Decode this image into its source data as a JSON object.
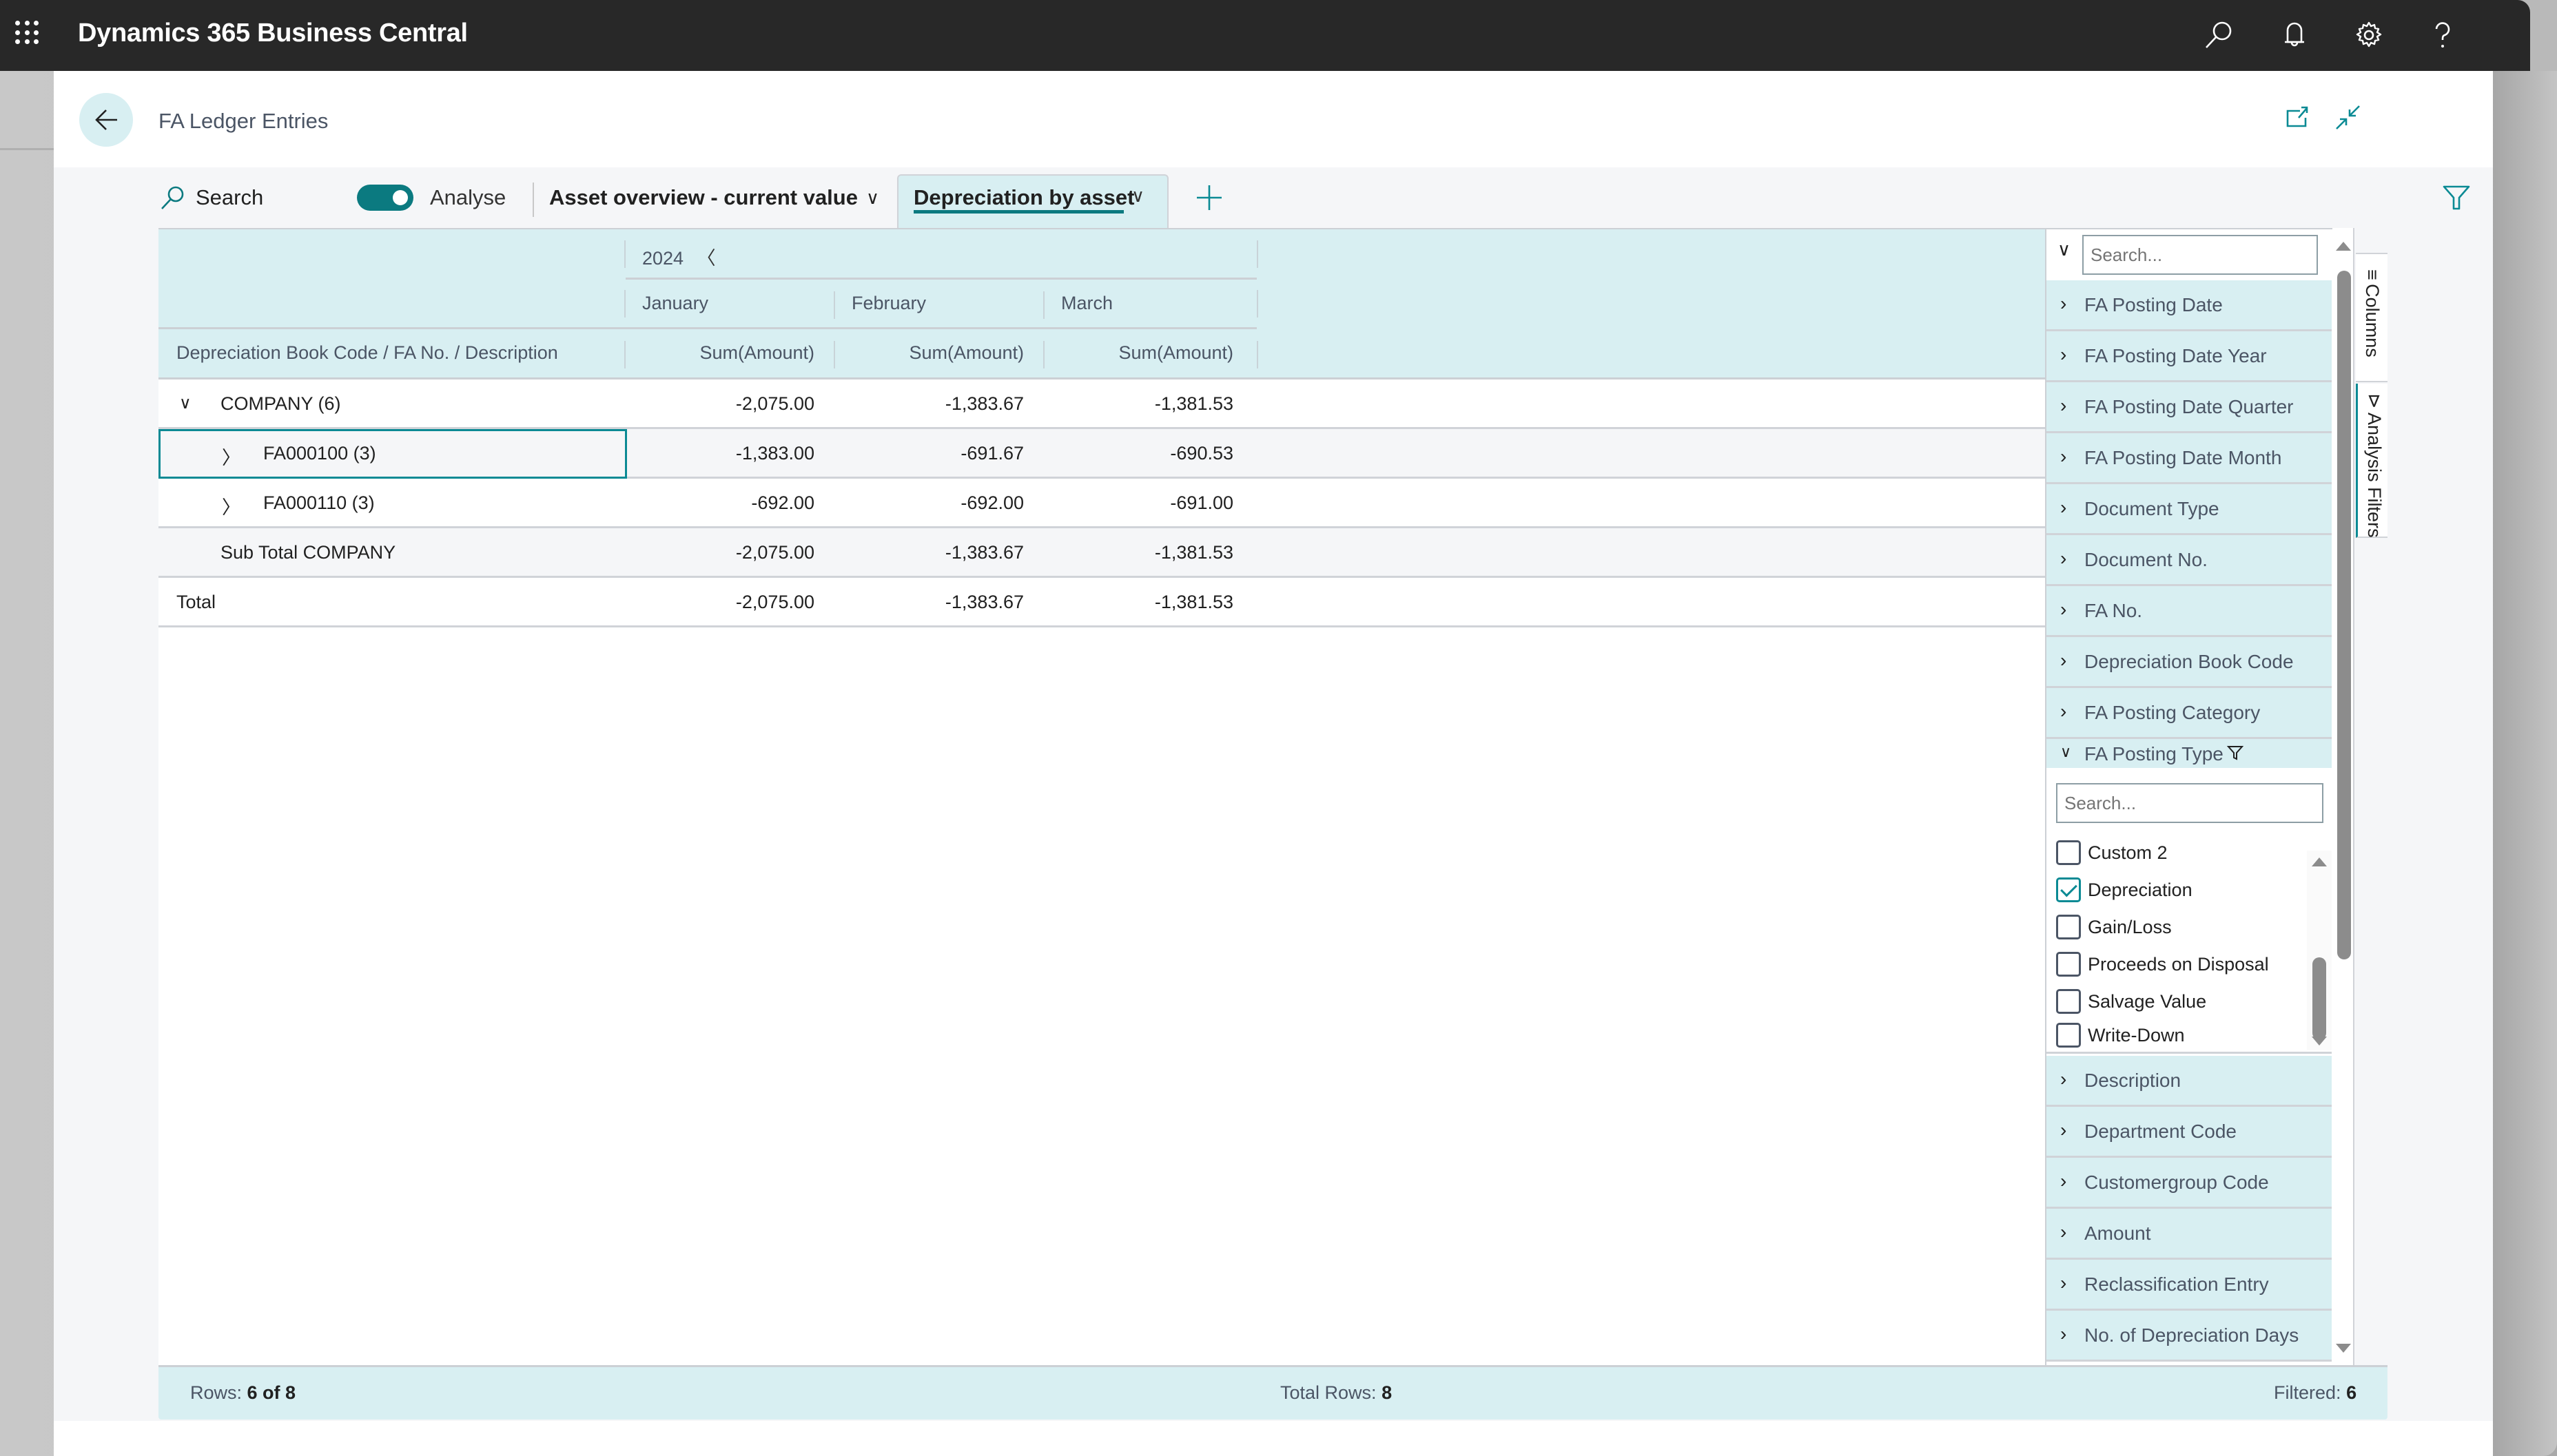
{
  "app": {
    "title": "Dynamics 365 Business Central",
    "icons": [
      "waffle-icon",
      "search-icon",
      "bell-icon",
      "gear-icon",
      "help-icon"
    ]
  },
  "page": {
    "title": "FA Ledger Entries",
    "header_icons": [
      "open-in-new-window-icon",
      "collapse-icon"
    ]
  },
  "toolbar": {
    "search_label": "Search",
    "analyse_label": "Analyse",
    "analyse_toggle_on": true,
    "tabs": [
      {
        "label": "Asset overview - current value",
        "active": false
      },
      {
        "label": "Depreciation by asset",
        "active": true
      }
    ],
    "add_tab_icon": "plus-icon",
    "filter_icon": "filter-icon"
  },
  "grid": {
    "year_header": "2024",
    "months": [
      "January",
      "February",
      "March"
    ],
    "row_group_header": "Depreciation Book Code / FA No. / Description",
    "value_header": "Sum(Amount)",
    "rows": [
      {
        "label": "COMPANY (6)",
        "level": 0,
        "expander": "expanded",
        "values": [
          "-2,075.00",
          "-1,383.67",
          "-1,381.53"
        ]
      },
      {
        "label": "FA000100 (3)",
        "level": 1,
        "expander": "collapsed",
        "selected": true,
        "values": [
          "-1,383.00",
          "-691.67",
          "-690.53"
        ]
      },
      {
        "label": "FA000110 (3)",
        "level": 1,
        "expander": "collapsed",
        "values": [
          "-692.00",
          "-692.00",
          "-691.00"
        ]
      },
      {
        "label": "Sub Total COMPANY",
        "level": 1,
        "expander": "none",
        "values": [
          "-2,075.00",
          "-1,383.67",
          "-1,381.53"
        ]
      },
      {
        "label": "Total",
        "level": 0,
        "expander": "none",
        "values": [
          "-2,075.00",
          "-1,383.67",
          "-1,381.53"
        ]
      }
    ]
  },
  "filters_panel": {
    "search_placeholder": "Search...",
    "fields_before": [
      "FA Posting Date",
      "FA Posting Date Year",
      "FA Posting Date Quarter",
      "FA Posting Date Month",
      "Document Type",
      "Document No.",
      "FA No.",
      "Depreciation Book Code",
      "FA Posting Category"
    ],
    "expanded_field": {
      "label": "FA Posting Type",
      "has_filter": true,
      "search_placeholder": "Search...",
      "options": [
        {
          "label": "Custom 2",
          "checked": false
        },
        {
          "label": "Depreciation",
          "checked": true
        },
        {
          "label": "Gain/Loss",
          "checked": false
        },
        {
          "label": "Proceeds on Disposal",
          "checked": false
        },
        {
          "label": "Salvage Value",
          "checked": false
        },
        {
          "label": "Write-Down",
          "checked": false
        }
      ]
    },
    "fields_after": [
      "Description",
      "Department Code",
      "Customergroup Code",
      "Amount",
      "Reclassification Entry",
      "No. of Depreciation Days"
    ]
  },
  "side_tabs": [
    {
      "label": "Columns",
      "icon": "columns-icon",
      "active": false
    },
    {
      "label": "Analysis Filters",
      "icon": "filter-icon",
      "active": true
    }
  ],
  "footer": {
    "rows_label": "Rows:",
    "rows_value": "6 of 8",
    "total_rows_label": "Total Rows:",
    "total_rows_value": "8",
    "filtered_label": "Filtered:",
    "filtered_value": "6"
  },
  "colors": {
    "accent": "#0b7a80",
    "header_bg": "#d8eff2",
    "appbar_bg": "#282828",
    "toolbar_bg": "#f5f6f8"
  }
}
